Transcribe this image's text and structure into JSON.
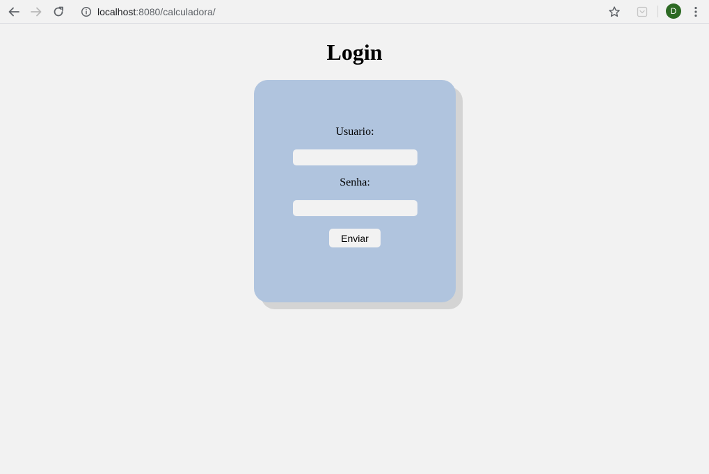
{
  "browser": {
    "url_host": "localhost",
    "url_path": ":8080/calculadora/",
    "profile_initial": "D",
    "icons": {
      "back": "back-arrow-icon",
      "forward": "forward-arrow-icon",
      "reload": "reload-icon",
      "site_info": "info-icon",
      "bookmark": "star-icon",
      "extension": "pocket-icon",
      "menu": "kebab-menu-icon"
    },
    "colors": {
      "avatar": "#2d6a24"
    }
  },
  "page": {
    "title": "Login",
    "colors": {
      "background": "#f2f2f2",
      "card": "#b0c4de",
      "card_shadow": "#d4d4d4"
    }
  },
  "form": {
    "username_label": "Usuario:",
    "username_value": "",
    "password_label": "Senha:",
    "password_value": "",
    "submit_label": "Enviar"
  }
}
